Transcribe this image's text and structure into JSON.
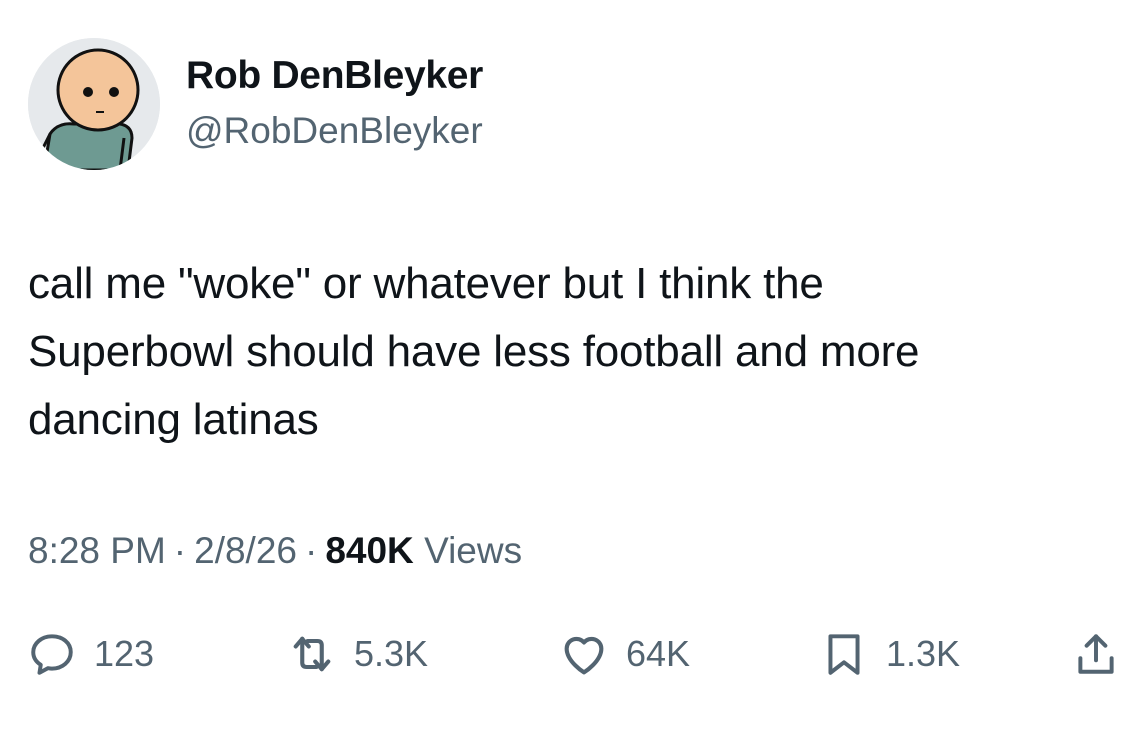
{
  "author": {
    "name": "Rob DenBleyker",
    "handle": "@RobDenBleyker",
    "avatar_icon": "cartoon-character-avatar"
  },
  "tweet": {
    "text_lines": [
      "call me \"woke\" or whatever but I think the",
      "Superbowl should have less football and more",
      "dancing latinas"
    ]
  },
  "meta": {
    "time": "8:28 PM",
    "separator": "·",
    "date": "2/8/26",
    "views_count": "840K",
    "views_label": "Views"
  },
  "actions": {
    "reply": {
      "icon": "reply-icon",
      "count": "123"
    },
    "retweet": {
      "icon": "retweet-icon",
      "count": "5.3K"
    },
    "like": {
      "icon": "heart-icon",
      "count": "64K"
    },
    "bookmark": {
      "icon": "bookmark-icon",
      "count": "1.3K"
    },
    "share": {
      "icon": "share-icon"
    }
  },
  "colors": {
    "text_primary": "#0f1419",
    "text_secondary": "#536471",
    "background": "#ffffff"
  }
}
